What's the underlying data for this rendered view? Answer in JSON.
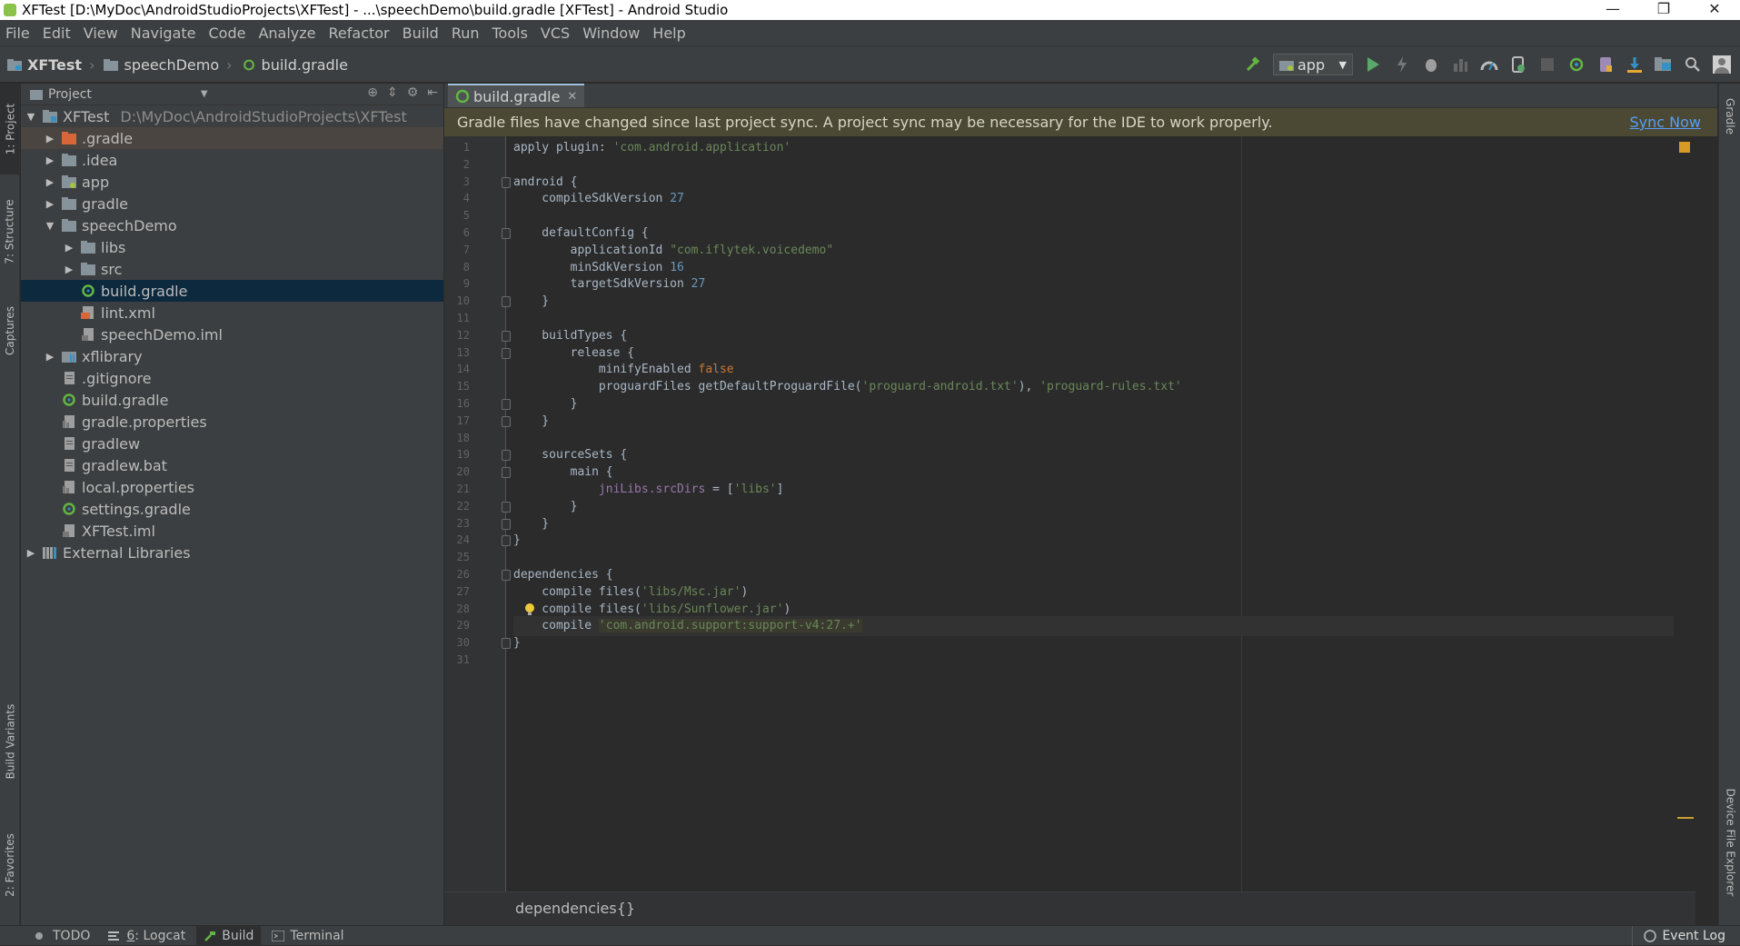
{
  "window": {
    "title": "XFTest [D:\\MyDoc\\AndroidStudioProjects\\XFTest] - ...\\speechDemo\\build.gradle [XFTest] - Android Studio",
    "minimize": "—",
    "restore": "❐",
    "close": "✕"
  },
  "menu": [
    "File",
    "Edit",
    "View",
    "Navigate",
    "Code",
    "Analyze",
    "Refactor",
    "Build",
    "Run",
    "Tools",
    "VCS",
    "Window",
    "Help"
  ],
  "breadcrumbs": [
    "XFTest",
    "speechDemo",
    "build.gradle"
  ],
  "toolbar": {
    "run_config": "app"
  },
  "left_strip": {
    "project": "1: Project",
    "structure": "7: Structure",
    "captures": "Captures",
    "build_variants": "Build Variants",
    "favorites": "2: Favorites"
  },
  "right_strip": {
    "gradle": "Gradle",
    "device_explorer": "Device File Explorer"
  },
  "project_panel": {
    "title": "Project",
    "tree": [
      {
        "label": "XFTest",
        "sub": "D:\\MyDoc\\AndroidStudioProjects\\XFTest",
        "depth": 0,
        "arrow": "down",
        "icon": "module-folder-icon"
      },
      {
        "label": ".gradle",
        "depth": 1,
        "arrow": "right",
        "icon": "folder-orange-icon"
      },
      {
        "label": ".idea",
        "depth": 1,
        "arrow": "right",
        "icon": "folder-icon"
      },
      {
        "label": "app",
        "depth": 1,
        "arrow": "right",
        "icon": "android-module-icon"
      },
      {
        "label": "gradle",
        "depth": 1,
        "arrow": "right",
        "icon": "folder-icon"
      },
      {
        "label": "speechDemo",
        "depth": 1,
        "arrow": "down",
        "icon": "folder-icon"
      },
      {
        "label": "libs",
        "depth": 2,
        "arrow": "right",
        "icon": "folder-icon"
      },
      {
        "label": "src",
        "depth": 2,
        "arrow": "right",
        "icon": "folder-icon"
      },
      {
        "label": "build.gradle",
        "depth": 2,
        "arrow": "",
        "icon": "gradle-icon"
      },
      {
        "label": "lint.xml",
        "depth": 2,
        "arrow": "",
        "icon": "xml-file-icon"
      },
      {
        "label": "speechDemo.iml",
        "depth": 2,
        "arrow": "",
        "icon": "iml-file-icon"
      },
      {
        "label": "xflibrary",
        "depth": 1,
        "arrow": "right",
        "icon": "library-module-icon"
      },
      {
        "label": ".gitignore",
        "depth": 1,
        "arrow": "",
        "icon": "text-file-icon"
      },
      {
        "label": "build.gradle",
        "depth": 1,
        "arrow": "",
        "icon": "gradle-icon"
      },
      {
        "label": "gradle.properties",
        "depth": 1,
        "arrow": "",
        "icon": "properties-file-icon"
      },
      {
        "label": "gradlew",
        "depth": 1,
        "arrow": "",
        "icon": "text-file-icon"
      },
      {
        "label": "gradlew.bat",
        "depth": 1,
        "arrow": "",
        "icon": "text-file-icon"
      },
      {
        "label": "local.properties",
        "depth": 1,
        "arrow": "",
        "icon": "properties-file-icon"
      },
      {
        "label": "settings.gradle",
        "depth": 1,
        "arrow": "",
        "icon": "gradle-icon"
      },
      {
        "label": "XFTest.iml",
        "depth": 1,
        "arrow": "",
        "icon": "iml-file-icon"
      },
      {
        "label": "External Libraries",
        "depth": 0,
        "arrow": "right",
        "icon": "libraries-icon"
      }
    ]
  },
  "editor": {
    "tab": "build.gradle",
    "notification": "Gradle files have changed since last project sync. A project sync may be necessary for the IDE to work properly.",
    "sync_link": "Sync Now",
    "breadcrumb": "dependencies{}",
    "lines": [
      "apply plugin: 'com.android.application'",
      "",
      "android {",
      "    compileSdkVersion 27",
      "",
      "    defaultConfig {",
      "        applicationId \"com.iflytek.voicedemo\"",
      "        minSdkVersion 16",
      "        targetSdkVersion 27",
      "    }",
      "",
      "    buildTypes {",
      "        release {",
      "            minifyEnabled false",
      "            proguardFiles getDefaultProguardFile('proguard-android.txt'), 'proguard-rules.txt'",
      "        }",
      "    }",
      "",
      "    sourceSets {",
      "        main {",
      "            jniLibs.srcDirs = ['libs']",
      "        }",
      "    }",
      "}",
      "",
      "dependencies {",
      "    compile files('libs/Msc.jar')",
      "    compile files('libs/Sunflower.jar')",
      "    compile 'com.android.support:support-v4:27.+'",
      "}",
      ""
    ]
  },
  "status": {
    "todo": "TODO",
    "logcat_num": "6",
    "logcat": ": Logcat",
    "build": "Build",
    "terminal": "Terminal",
    "event_log": "Event Log"
  }
}
